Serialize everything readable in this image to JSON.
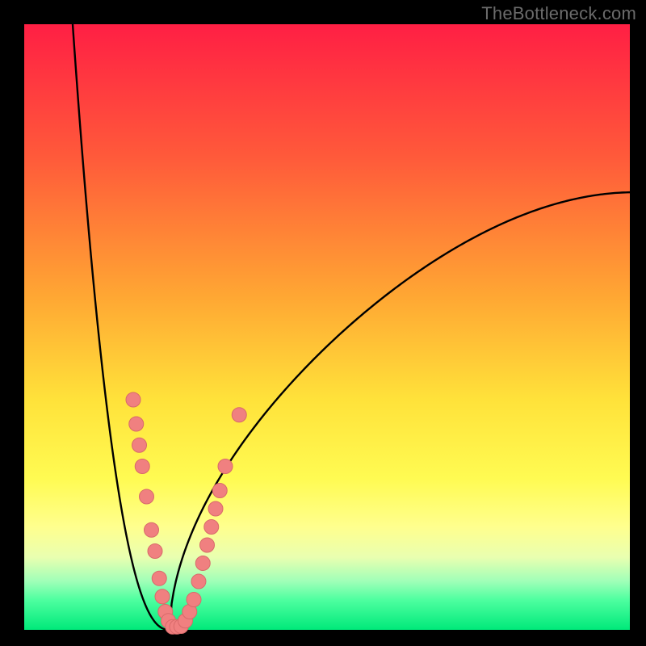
{
  "watermark": "TheBottleneck.com",
  "colors": {
    "frame": "#000000",
    "curve": "#000000",
    "marker_fill": "#f08080",
    "marker_stroke": "#d86a6a"
  },
  "chart_data": {
    "type": "line",
    "title": "",
    "xlabel": "",
    "ylabel": "",
    "xlim": [
      0,
      100
    ],
    "ylim": [
      0,
      100
    ],
    "grid": false,
    "legend": false,
    "series": [
      {
        "name": "bottleneck-curve",
        "description": "V-shaped bottleneck curve; minimum near x≈24, y≈0",
        "x_min": 24,
        "y_min": 0,
        "left_endpoint": {
          "x": 8,
          "y": 100
        },
        "right_endpoint": {
          "x": 100,
          "y": 85
        }
      }
    ],
    "markers": [
      {
        "x": 18.0,
        "y": 38.0
      },
      {
        "x": 18.5,
        "y": 34.0
      },
      {
        "x": 19.0,
        "y": 30.5
      },
      {
        "x": 19.5,
        "y": 27.0
      },
      {
        "x": 20.2,
        "y": 22.0
      },
      {
        "x": 21.0,
        "y": 16.5
      },
      {
        "x": 21.6,
        "y": 13.0
      },
      {
        "x": 22.3,
        "y": 8.5
      },
      {
        "x": 22.8,
        "y": 5.5
      },
      {
        "x": 23.3,
        "y": 3.0
      },
      {
        "x": 23.8,
        "y": 1.5
      },
      {
        "x": 24.5,
        "y": 0.5
      },
      {
        "x": 25.2,
        "y": 0.5
      },
      {
        "x": 25.9,
        "y": 0.6
      },
      {
        "x": 26.6,
        "y": 1.5
      },
      {
        "x": 27.3,
        "y": 3.0
      },
      {
        "x": 28.0,
        "y": 5.0
      },
      {
        "x": 28.8,
        "y": 8.0
      },
      {
        "x": 29.5,
        "y": 11.0
      },
      {
        "x": 30.2,
        "y": 14.0
      },
      {
        "x": 30.9,
        "y": 17.0
      },
      {
        "x": 31.6,
        "y": 20.0
      },
      {
        "x": 32.3,
        "y": 23.0
      },
      {
        "x": 33.2,
        "y": 27.0
      },
      {
        "x": 35.5,
        "y": 35.5
      }
    ]
  }
}
